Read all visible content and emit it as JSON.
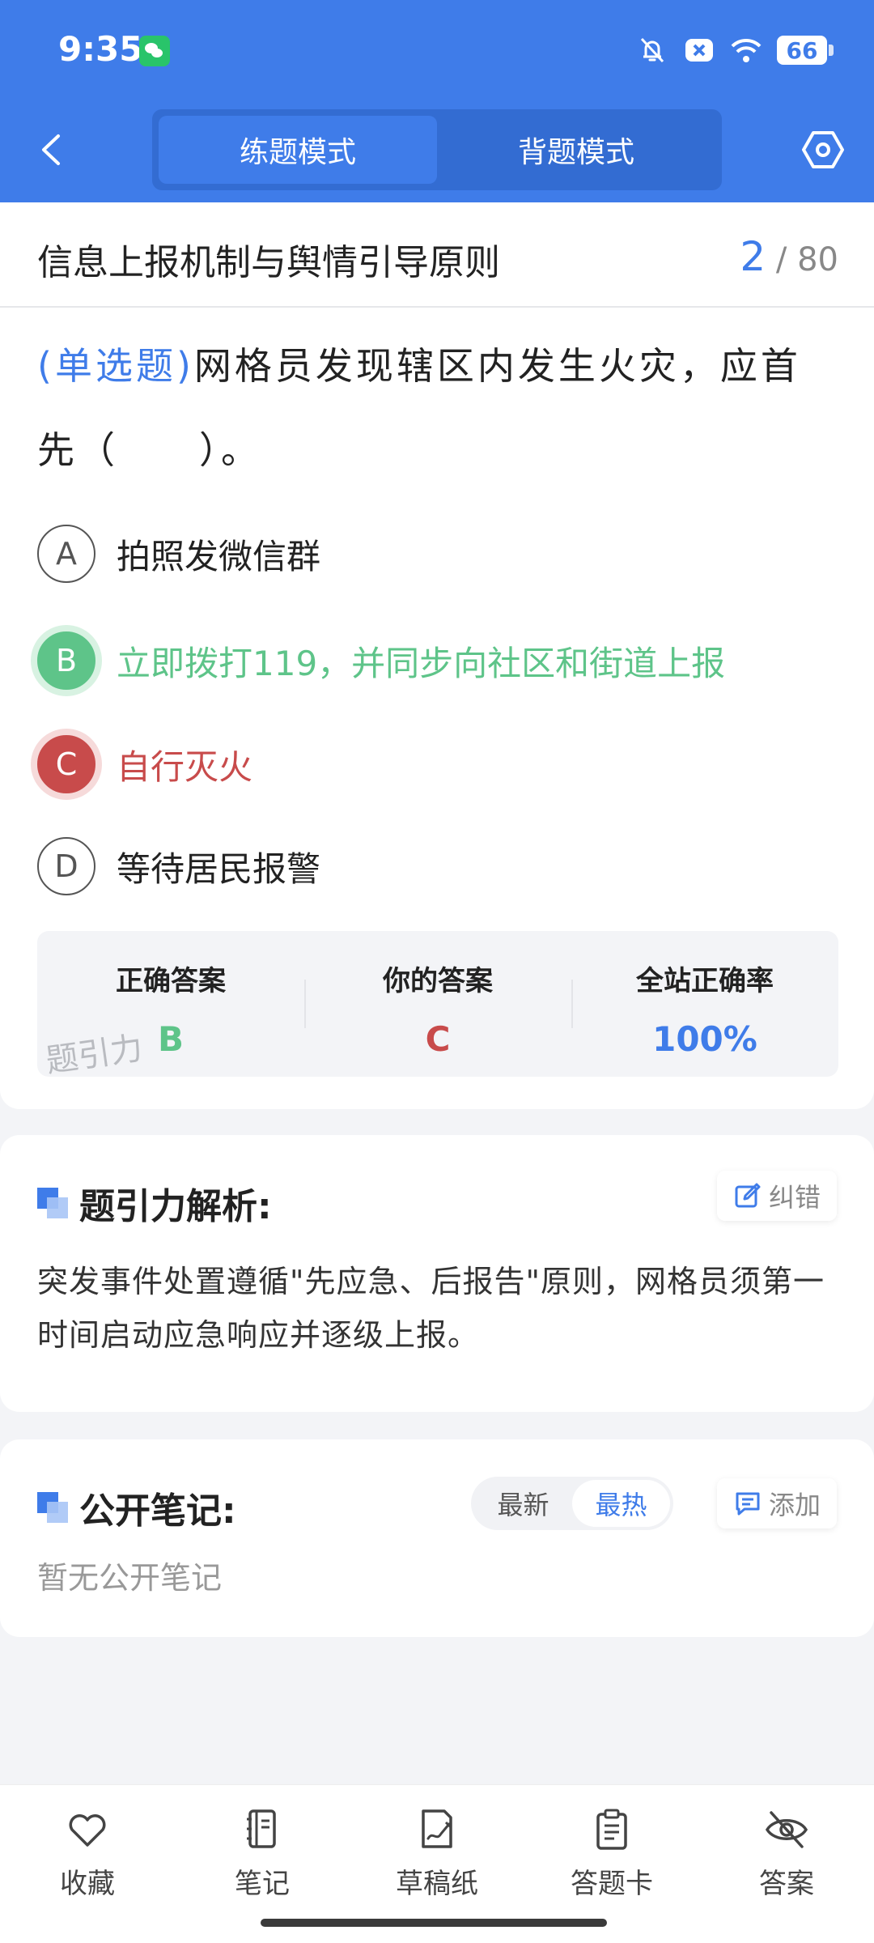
{
  "status_bar": {
    "time": "9:35",
    "battery": "66"
  },
  "header": {
    "tabs": [
      {
        "label": "练题模式",
        "active": true
      },
      {
        "label": "背题模式",
        "active": false
      }
    ]
  },
  "question": {
    "chapter": "信息上报机制与舆情引导原则",
    "current": "2",
    "total": "/ 80",
    "type": "(单选题)",
    "text": "网格员发现辖区内发生火灾，应首先（　　）。",
    "options": [
      {
        "letter": "A",
        "text": "拍照发微信群",
        "state": "normal"
      },
      {
        "letter": "B",
        "text": "立即拨打119，并同步向社区和街道上报",
        "state": "correct"
      },
      {
        "letter": "C",
        "text": "自行灭火",
        "state": "wrong"
      },
      {
        "letter": "D",
        "text": "等待居民报警",
        "state": "normal"
      }
    ]
  },
  "answers": {
    "correct_label": "正确答案",
    "correct_value": "B",
    "yours_label": "你的答案",
    "yours_value": "C",
    "rate_label": "全站正确率",
    "rate_value": "100%",
    "watermark": "题引力"
  },
  "analysis": {
    "title": "题引力解析:",
    "report_label": "纠错",
    "text": "突发事件处置遵循\"先应急、后报告\"原则，网格员须第一时间启动应急响应并逐级上报。"
  },
  "notes": {
    "title": "公开笔记:",
    "sort_new": "最新",
    "sort_hot": "最热",
    "add_label": "添加",
    "empty": "暂无公开笔记"
  },
  "bottom_nav": [
    {
      "label": "收藏",
      "icon": "heart-icon"
    },
    {
      "label": "笔记",
      "icon": "notebook-icon"
    },
    {
      "label": "草稿纸",
      "icon": "draft-icon"
    },
    {
      "label": "答题卡",
      "icon": "answer-sheet-icon"
    },
    {
      "label": "答案",
      "icon": "eye-off-icon"
    }
  ],
  "colors": {
    "primary": "#3f7ce9",
    "correct": "#5ec489",
    "wrong": "#c84b4b"
  }
}
